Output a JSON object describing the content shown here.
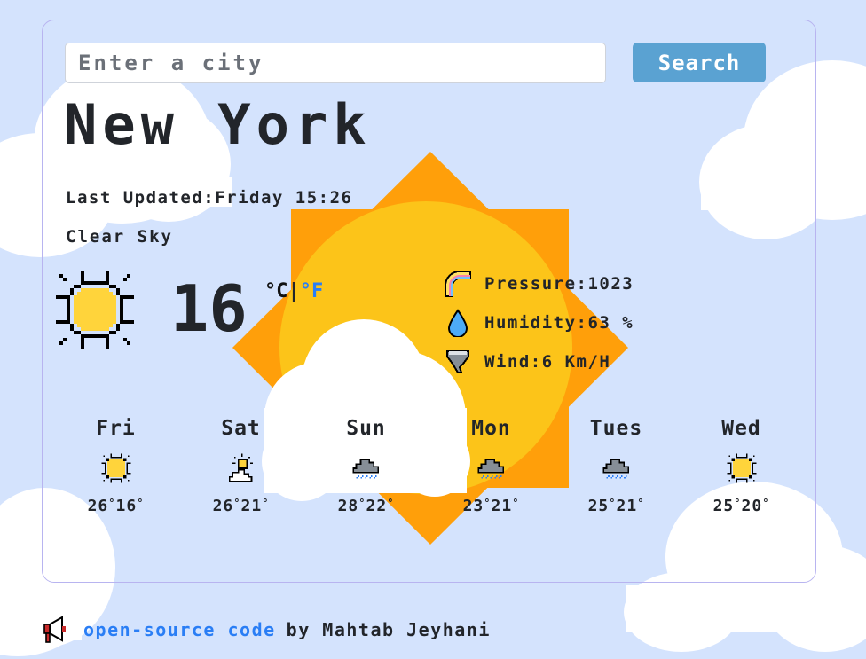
{
  "search": {
    "placeholder": "Enter a city",
    "value": "",
    "button_label": "Search"
  },
  "current": {
    "city": "New York",
    "last_updated_label": "Last Updated:",
    "last_updated_value": "Friday 15:26",
    "description": "Clear Sky",
    "icon": "sun-icon",
    "temperature": "16",
    "unit_celsius": "°C",
    "unit_separator": "|",
    "unit_fahrenheit": "°F",
    "details": [
      {
        "icon": "rainbow-icon",
        "label": "Pressure:",
        "value": "1023"
      },
      {
        "icon": "water-drop-icon",
        "label": "Humidity:",
        "value": "63 %"
      },
      {
        "icon": "tornado-icon",
        "label": "Wind:",
        "value": "6 Km/H"
      }
    ]
  },
  "forecast": [
    {
      "day": "Fri",
      "icon": "sun-icon",
      "max": "26",
      "min": "16"
    },
    {
      "day": "Sat",
      "icon": "sun-behind-cloud-icon",
      "max": "26",
      "min": "21"
    },
    {
      "day": "Sun",
      "icon": "rain-cloud-icon",
      "max": "28",
      "min": "22"
    },
    {
      "day": "Mon",
      "icon": "rain-cloud-icon",
      "max": "23",
      "min": "21"
    },
    {
      "day": "Tues",
      "icon": "rain-cloud-icon",
      "max": "25",
      "min": "21"
    },
    {
      "day": "Wed",
      "icon": "sun-icon",
      "max": "25",
      "min": "20"
    }
  ],
  "degree_symbol": "°",
  "footer": {
    "link_text": "open-source code",
    "by_text": "by Mahtab Jeyhani"
  },
  "colors": {
    "background": "#d4e3fd",
    "accent": "#5aa2d2",
    "link": "#2a7ef5",
    "sun_orange": "#ff9f0a",
    "sun_yellow": "#fcc419"
  }
}
